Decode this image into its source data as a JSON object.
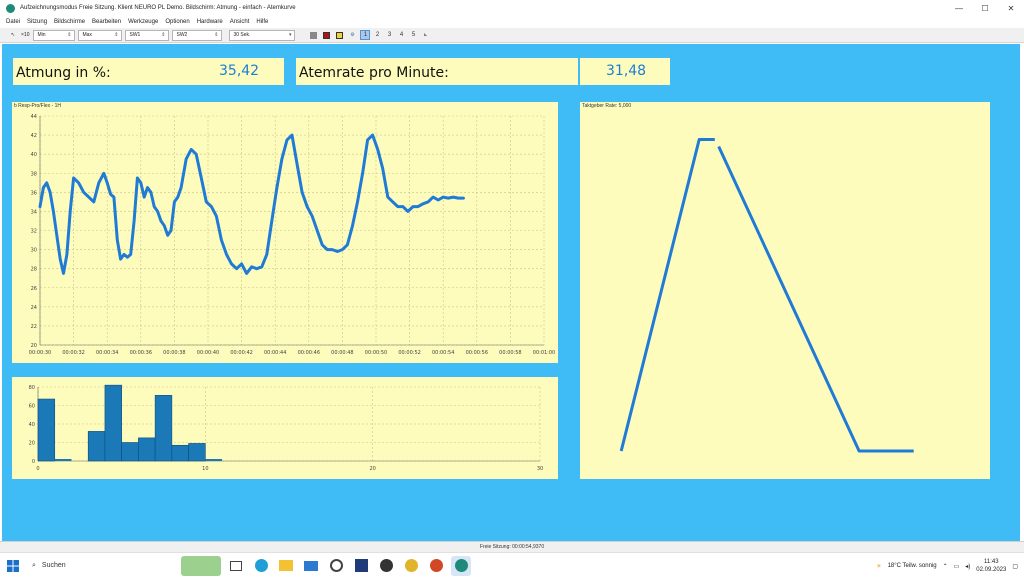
{
  "window": {
    "title": "Aufzeichnungsmodus Freie Sitzung. Klient NEURO PL Demo. Bildschirm: Atmung - einfach - Atemkurve",
    "controls": [
      "—",
      "☐",
      "✕"
    ]
  },
  "menu": [
    "Datei",
    "Sitzung",
    "Bildschirme",
    "Bearbeiten",
    "Werkzeuge",
    "Optionen",
    "Hardware",
    "Ansicht",
    "Hilfe"
  ],
  "toolbar": {
    "scale_label": "×10",
    "selects": [
      "Min",
      "Max",
      "SW1",
      "SW2",
      "30 Sek."
    ],
    "pages": [
      "1",
      "2",
      "3",
      "4",
      "5"
    ],
    "active_page": "1"
  },
  "colors": {
    "workspace": "#3fbcf5",
    "panel": "#fdfcbd",
    "curve": "#1f7bd6",
    "bars": "#1b79b8"
  },
  "displays": {
    "breath_label": "Atmung in %:",
    "breath_value": "35,42",
    "rate_label": "Atemrate pro Minute:",
    "rate_value": "31,48"
  },
  "chart_data": [
    {
      "type": "line",
      "title": "b Resp-Pro/Flex - 1H",
      "ylim": [
        20,
        44
      ],
      "yticks": [
        20,
        22,
        24,
        26,
        28,
        30,
        32,
        34,
        36,
        38,
        40,
        42,
        44
      ],
      "xticks": [
        "00:00:30",
        "00:00:32",
        "00:00:34",
        "00:00:36",
        "00:00:38",
        "00:00:40",
        "00:00:42",
        "00:00:44",
        "00:00:46",
        "00:00:48",
        "00:00:50",
        "00:00:52",
        "00:00:54",
        "00:00:56",
        "00:00:58",
        "00:01:00"
      ],
      "grid": true,
      "series": [
        {
          "x": [
            30.0,
            30.2,
            30.4,
            30.6,
            30.8,
            31.0,
            31.2,
            31.4,
            31.6,
            31.8,
            32.0,
            32.3,
            32.6,
            32.9,
            33.2,
            33.5,
            33.8,
            34.0,
            34.2,
            34.4,
            34.6,
            34.8,
            35.0,
            35.2,
            35.4,
            35.6,
            35.8,
            36.0,
            36.2,
            36.4,
            36.6,
            36.8,
            37.0,
            37.2,
            37.4,
            37.6,
            37.8,
            38.0,
            38.2,
            38.4,
            38.7,
            39.0,
            39.3,
            39.6,
            39.9,
            40.2,
            40.5,
            40.8,
            41.1,
            41.4,
            41.7,
            42.0,
            42.3,
            42.6,
            42.9,
            43.2,
            43.5,
            43.8,
            44.1,
            44.4,
            44.7,
            45.0,
            45.3,
            45.6,
            45.9,
            46.2,
            46.5,
            46.8,
            47.1,
            47.4,
            47.7,
            48.0,
            48.3,
            48.6,
            48.9,
            49.2,
            49.5,
            49.8,
            50.1,
            50.4,
            50.7,
            51.0,
            51.3,
            51.6,
            51.9,
            52.2,
            52.5,
            52.8,
            53.1,
            53.4,
            53.7,
            54.0,
            54.3,
            54.6,
            54.9,
            55.2
          ],
          "y": [
            34.5,
            36.5,
            37.0,
            36.0,
            34.0,
            31.5,
            29.0,
            27.5,
            29.5,
            34.0,
            37.5,
            37.0,
            36.0,
            35.5,
            35.0,
            37.0,
            38.0,
            37.0,
            35.8,
            35.5,
            31.0,
            29.0,
            29.5,
            29.2,
            29.5,
            33.0,
            37.5,
            37.0,
            35.5,
            36.5,
            36.0,
            34.5,
            34.0,
            33.0,
            32.5,
            31.5,
            32.0,
            35.0,
            35.5,
            36.5,
            39.5,
            40.5,
            40.0,
            37.5,
            35.0,
            34.5,
            33.5,
            31.0,
            29.5,
            28.5,
            28.0,
            28.5,
            27.5,
            28.2,
            28.0,
            28.2,
            29.5,
            33.0,
            36.5,
            39.5,
            41.5,
            42.0,
            39.0,
            36.0,
            34.5,
            33.5,
            32.0,
            30.5,
            30.0,
            30.0,
            29.8,
            30.0,
            30.5,
            32.5,
            35.0,
            38.0,
            41.5,
            42.0,
            40.5,
            38.5,
            35.5,
            35.0,
            34.5,
            34.5,
            34.0,
            34.5,
            34.5,
            34.8,
            35.0,
            35.5,
            35.2,
            35.5,
            35.4,
            35.5,
            35.4,
            35.4
          ]
        }
      ]
    },
    {
      "type": "bar",
      "ylim": [
        0,
        80
      ],
      "yticks": [
        0,
        20,
        40,
        60,
        80
      ],
      "xlim": [
        0,
        30
      ],
      "xticks": [
        0,
        10,
        20,
        30
      ],
      "bar_width": 1,
      "x": [
        0.5,
        1.5,
        3.5,
        4.5,
        5.5,
        6.5,
        7.5,
        8.5,
        9.5,
        10.5
      ],
      "values": [
        67,
        0,
        32,
        82,
        20,
        25,
        71,
        17,
        19,
        0
      ]
    },
    {
      "type": "line",
      "title": "Taktgeber Rate: 5,000",
      "xlim": [
        0,
        1
      ],
      "ylim": [
        0,
        1
      ],
      "series": [
        {
          "x": [
            0.08,
            0.28,
            0.32
          ],
          "y": [
            0.06,
            0.95,
            0.95
          ]
        },
        {
          "x": [
            0.33,
            0.69,
            0.83
          ],
          "y": [
            0.93,
            0.06,
            0.06
          ]
        }
      ]
    }
  ],
  "status": "Freie Sitzung: 00:00:54,9370",
  "taskbar": {
    "search": "Suchen",
    "apps": [
      "widgets-icon",
      "edge-icon",
      "explorer-icon",
      "mail-icon",
      "dell-icon",
      "word-icon",
      "app-icon",
      "chrome-icon",
      "powerpoint-icon",
      "neuro-icon"
    ],
    "weather": "18°C  Teilw. sonnig",
    "time": "11:43",
    "date": "02.09.2023"
  }
}
